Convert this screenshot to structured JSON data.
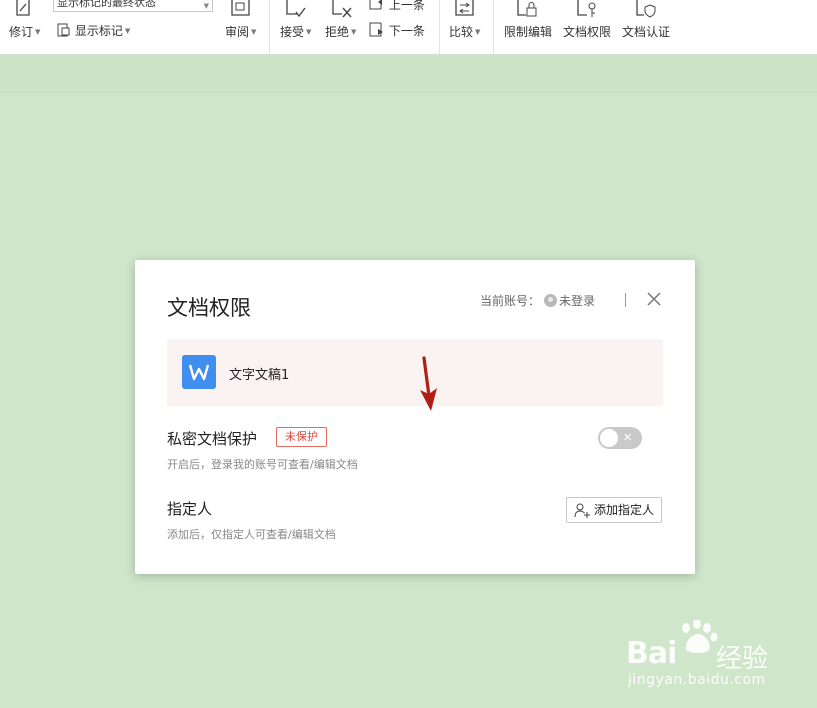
{
  "ribbon": {
    "revise_label": "修订",
    "markup_state_value": "显示标记的最终状态",
    "show_markup_label": "显示标记",
    "review_label": "审阅",
    "accept_label": "接受",
    "reject_label": "拒绝",
    "prev_label": "上一条",
    "next_label": "下一条",
    "compare_label": "比较",
    "restrict_edit_label": "限制编辑",
    "doc_permission_label": "文档权限",
    "doc_auth_label": "文档认证"
  },
  "dialog": {
    "title": "文档权限",
    "account_label": "当前账号：",
    "account_status": "未登录",
    "document_name": "文字文稿1",
    "private_protection": {
      "title": "私密文档保护",
      "badge": "未保护",
      "description": "开启后，登录我的账号可查看/编辑文档",
      "toggle_on": false
    },
    "designee": {
      "title": "指定人",
      "description": "添加后，仅指定人可查看/编辑文档",
      "add_button": "添加指定人"
    }
  },
  "watermark": {
    "brand_latin": "Bai",
    "brand_cn": "经验",
    "url": "jingyan.baidu.com"
  },
  "colors": {
    "page_background": "#cfe6cb",
    "badge_red": "#e0463c",
    "doc_icon_blue": "#3f8ef0",
    "arrow_red": "#b01e14"
  }
}
